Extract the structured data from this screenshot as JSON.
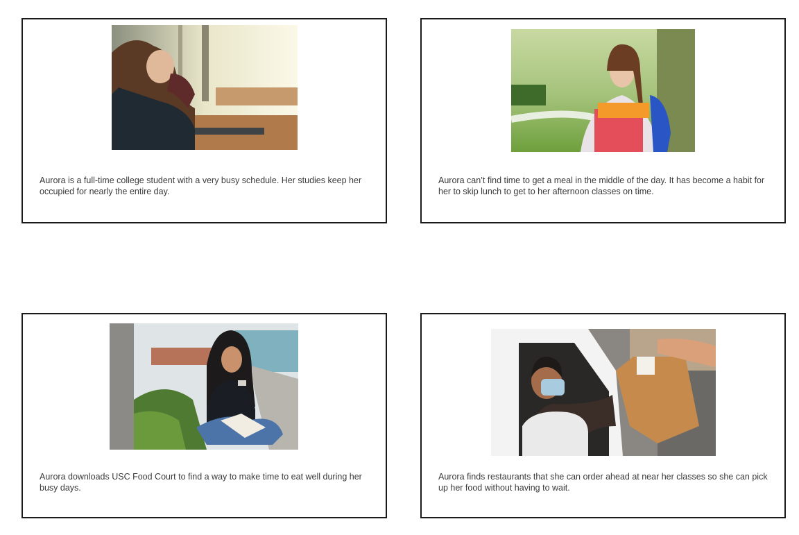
{
  "panels": [
    {
      "caption": "Aurora is a full-time college student with a very busy schedule. Her studies keep her occupied for nearly the entire day.",
      "image": "student-resting-on-desk-photo"
    },
    {
      "caption": "Aurora can’t find time to get a meal in the middle of the day. It has become a habit for her to skip lunch to get to her afternoon classes on time.",
      "image": "student-carrying-folders-photo"
    },
    {
      "caption": "Aurora downloads USC Food Court to find a way to make time to eat well during her busy days.",
      "image": "student-using-phone-photo"
    },
    {
      "caption": "Aurora finds restaurants that she can order ahead at near her classes so she can pick up her food without having to wait.",
      "image": "curbside-pickup-photo"
    }
  ]
}
